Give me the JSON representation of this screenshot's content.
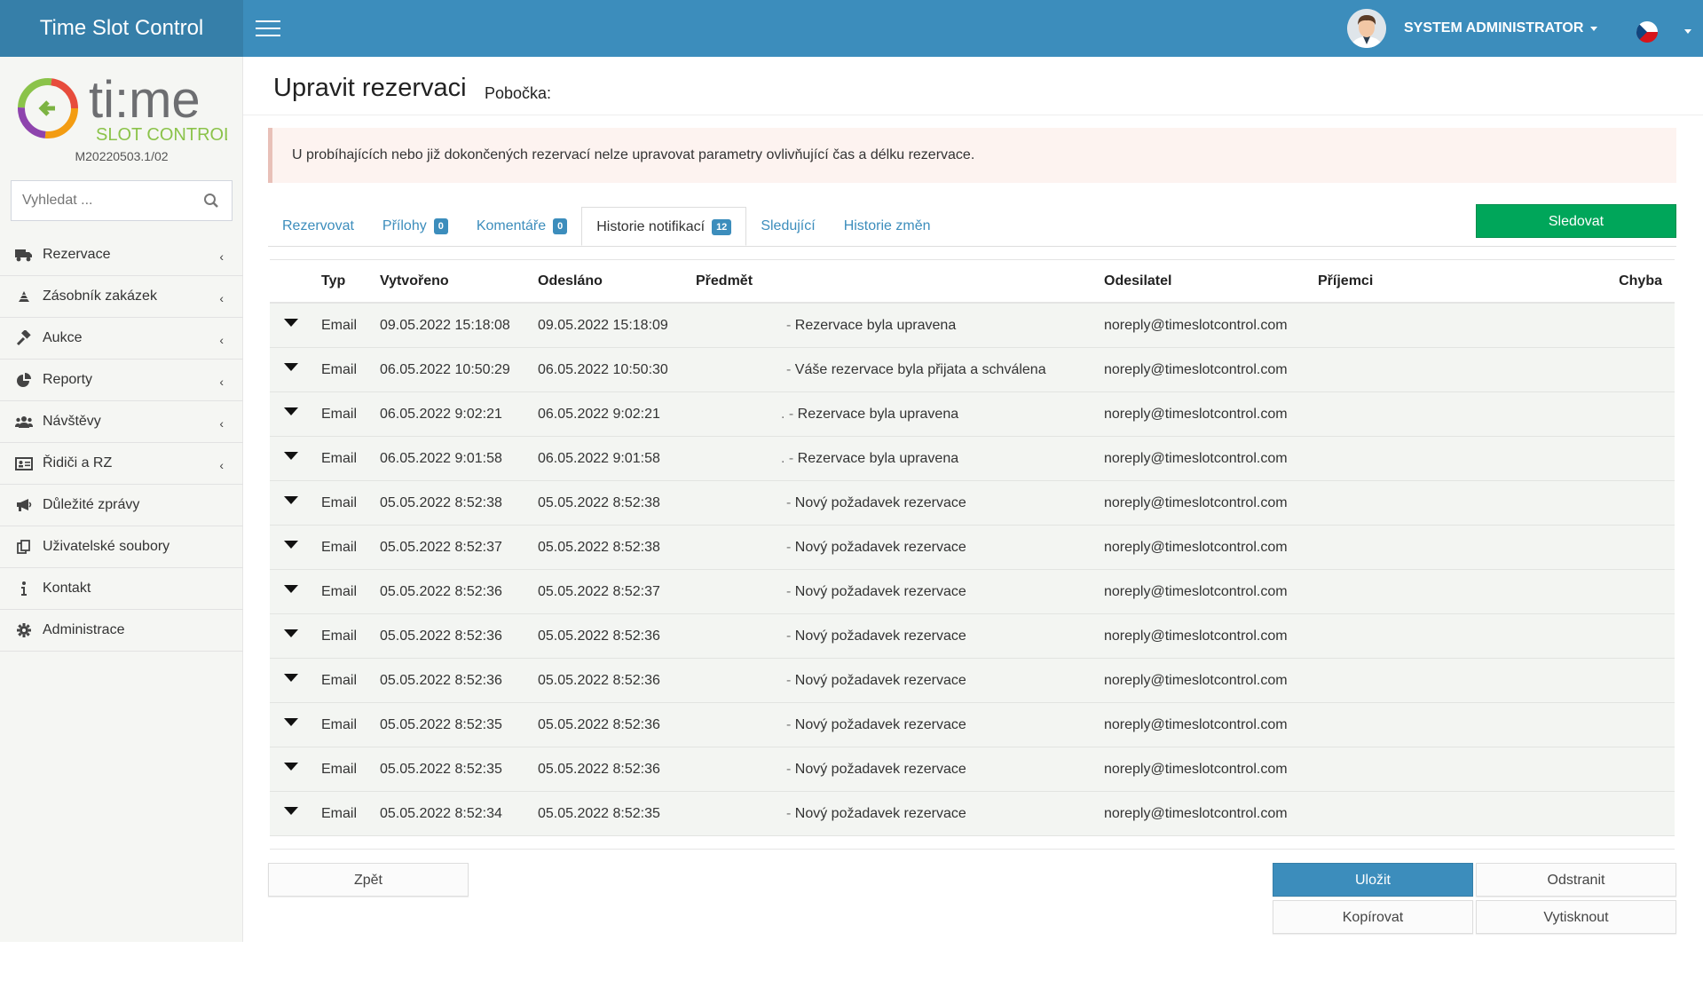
{
  "app": {
    "brand": "Time Slot Control",
    "version": "M20220503.1/02",
    "logo_text_main": "ti:me",
    "logo_text_sub": "SLOT CONTROL"
  },
  "topbar": {
    "user_name": "SYSTEM ADMINISTRATOR",
    "menu_icon": "hamburger-icon",
    "language_flag": "czech-flag-icon"
  },
  "sidebar": {
    "search_placeholder": "Vyhledat ...",
    "items": [
      {
        "label": "Rezervace",
        "icon": "truck-icon",
        "has_submenu": true
      },
      {
        "label": "Zásobník zakázek",
        "icon": "stack-icon",
        "has_submenu": true
      },
      {
        "label": "Aukce",
        "icon": "gavel-icon",
        "has_submenu": true
      },
      {
        "label": "Reporty",
        "icon": "pie-chart-icon",
        "has_submenu": true
      },
      {
        "label": "Návštěvy",
        "icon": "users-icon",
        "has_submenu": true
      },
      {
        "label": "Řidiči a RZ",
        "icon": "id-card-icon",
        "has_submenu": true
      },
      {
        "label": "Důležité zprávy",
        "icon": "megaphone-icon",
        "has_submenu": false
      },
      {
        "label": "Uživatelské soubory",
        "icon": "files-icon",
        "has_submenu": false
      },
      {
        "label": "Kontakt",
        "icon": "info-icon",
        "has_submenu": false
      },
      {
        "label": "Administrace",
        "icon": "gear-icon",
        "has_submenu": false
      }
    ]
  },
  "page": {
    "title": "Upravit rezervaci",
    "subtitle": "Pobočka:",
    "alert": "U probíhajících nebo již dokončených rezervací nelze upravovat parametry ovlivňující čas a délku rezervace."
  },
  "tabs": [
    {
      "label": "Rezervovat",
      "badge": null,
      "active": false
    },
    {
      "label": "Přílohy",
      "badge": "0",
      "active": false
    },
    {
      "label": "Komentáře",
      "badge": "0",
      "active": false
    },
    {
      "label": "Historie notifikací",
      "badge": "12",
      "active": true
    },
    {
      "label": "Sledující",
      "badge": null,
      "active": false
    },
    {
      "label": "Historie změn",
      "badge": null,
      "active": false
    }
  ],
  "follow_button": "Sledovat",
  "table": {
    "headers": {
      "type": "Typ",
      "created": "Vytvořeno",
      "sent": "Odesláno",
      "subject": "Předmět",
      "sender": "Odesilatel",
      "recipients": "Příjemci",
      "error": "Chyba"
    },
    "rows": [
      {
        "type": "Email",
        "created": "09.05.2022 15:18:08",
        "sent": "09.05.2022 15:18:09",
        "prefix": "- ",
        "subject": "Rezervace byla upravena",
        "sender": "noreply@timeslotcontrol.com"
      },
      {
        "type": "Email",
        "created": "06.05.2022 10:50:29",
        "sent": "06.05.2022 10:50:30",
        "prefix": "- ",
        "subject": "Váše rezervace byla přijata a schválena",
        "sender": "noreply@timeslotcontrol.com"
      },
      {
        "type": "Email",
        "created": "06.05.2022 9:02:21",
        "sent": "06.05.2022 9:02:21",
        "prefix": ". - ",
        "subject": "Rezervace byla upravena",
        "sender": "noreply@timeslotcontrol.com"
      },
      {
        "type": "Email",
        "created": "06.05.2022 9:01:58",
        "sent": "06.05.2022 9:01:58",
        "prefix": ". - ",
        "subject": "Rezervace byla upravena",
        "sender": "noreply@timeslotcontrol.com"
      },
      {
        "type": "Email",
        "created": "05.05.2022 8:52:38",
        "sent": "05.05.2022 8:52:38",
        "prefix": "- ",
        "subject": "Nový požadavek rezervace",
        "sender": "noreply@timeslotcontrol.com"
      },
      {
        "type": "Email",
        "created": "05.05.2022 8:52:37",
        "sent": "05.05.2022 8:52:38",
        "prefix": "- ",
        "subject": "Nový požadavek rezervace",
        "sender": "noreply@timeslotcontrol.com"
      },
      {
        "type": "Email",
        "created": "05.05.2022 8:52:36",
        "sent": "05.05.2022 8:52:37",
        "prefix": "- ",
        "subject": "Nový požadavek rezervace",
        "sender": "noreply@timeslotcontrol.com"
      },
      {
        "type": "Email",
        "created": "05.05.2022 8:52:36",
        "sent": "05.05.2022 8:52:36",
        "prefix": "- ",
        "subject": "Nový požadavek rezervace",
        "sender": "noreply@timeslotcontrol.com"
      },
      {
        "type": "Email",
        "created": "05.05.2022 8:52:36",
        "sent": "05.05.2022 8:52:36",
        "prefix": "- ",
        "subject": "Nový požadavek rezervace",
        "sender": "noreply@timeslotcontrol.com"
      },
      {
        "type": "Email",
        "created": "05.05.2022 8:52:35",
        "sent": "05.05.2022 8:52:36",
        "prefix": "- ",
        "subject": "Nový požadavek rezervace",
        "sender": "noreply@timeslotcontrol.com"
      },
      {
        "type": "Email",
        "created": "05.05.2022 8:52:35",
        "sent": "05.05.2022 8:52:36",
        "prefix": "- ",
        "subject": "Nový požadavek rezervace",
        "sender": "noreply@timeslotcontrol.com"
      },
      {
        "type": "Email",
        "created": "05.05.2022 8:52:34",
        "sent": "05.05.2022 8:52:35",
        "prefix": "- ",
        "subject": "Nový požadavek rezervace",
        "sender": "noreply@timeslotcontrol.com"
      }
    ]
  },
  "footer": {
    "back": "Zpět",
    "save": "Uložit",
    "delete": "Odstranit",
    "copy": "Kopírovat",
    "print": "Vytisknout"
  },
  "colors": {
    "topbar": "#3c8dbc",
    "brand": "#367fa9",
    "follow": "#00a65a",
    "primary": "#3c8dbc"
  }
}
